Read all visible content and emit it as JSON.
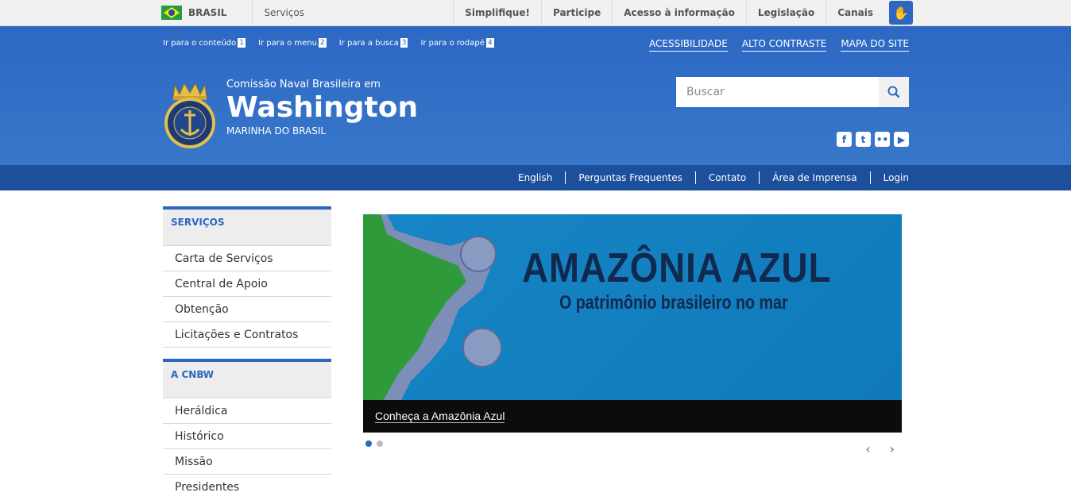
{
  "gov_bar": {
    "brasil": "BRASIL",
    "servicos": "Serviços",
    "links": [
      "Simplifique!",
      "Participe",
      "Acesso à informação",
      "Legislação",
      "Canais"
    ]
  },
  "accesskeys": [
    {
      "label": "Ir para o conteúdo",
      "num": "1"
    },
    {
      "label": "Ir para o menu",
      "num": "2"
    },
    {
      "label": "Ir para a busca",
      "num": "3"
    },
    {
      "label": "Ir para o rodapé",
      "num": "4"
    }
  ],
  "toplinks": [
    "ACESSIBILIDADE",
    "ALTO CONTRASTE",
    "MAPA DO SITE"
  ],
  "site": {
    "pre_title": "Comissão Naval Brasileira em",
    "title": "Washington",
    "subtitle": "MARINHA DO BRASIL"
  },
  "search": {
    "placeholder": "Buscar"
  },
  "social": [
    "facebook-icon",
    "twitter-icon",
    "flickr-icon",
    "youtube-icon"
  ],
  "service_links": [
    "English",
    "Perguntas Frequentes",
    "Contato",
    "Área de Imprensa",
    "Login"
  ],
  "sidebar": {
    "sections": [
      {
        "title": "SERVIÇOS",
        "items": [
          "Carta de Serviços",
          "Central de Apoio",
          "Obtenção",
          "Licitações e Contratos"
        ]
      },
      {
        "title": "A CNBW",
        "items": [
          "Heráldica",
          "Histórico",
          "Missão",
          "Presidentes"
        ]
      }
    ]
  },
  "carousel": {
    "banner_title": "AMAZÔNIA AZUL",
    "banner_subtitle": "O patrimônio brasileiro no mar",
    "caption": "Conheça a Amazônia Azul",
    "prev": "‹",
    "next": "›"
  }
}
